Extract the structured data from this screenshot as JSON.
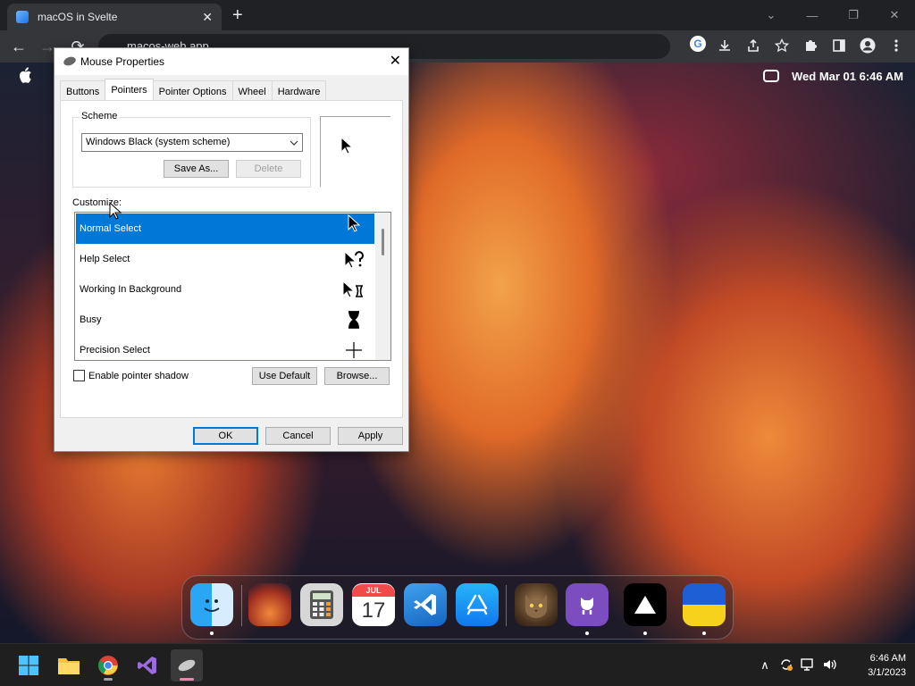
{
  "browser": {
    "tab_title": "macOS in Svelte",
    "tab_close": "✕",
    "new_tab": "+",
    "url": "macos-web.app",
    "back": "←",
    "forward": "→",
    "reload": "⟳",
    "win_min": "—",
    "win_restore": "❐",
    "win_close": "✕",
    "chevron": "⌄",
    "google": "G"
  },
  "menubar": {
    "apple": "",
    "clock": "Wed Mar 01  6:46 AM"
  },
  "dialog": {
    "title": "Mouse Properties",
    "close": "✕",
    "tabs": [
      {
        "label": "Buttons"
      },
      {
        "label": "Pointers",
        "active": true
      },
      {
        "label": "Pointer Options"
      },
      {
        "label": "Wheel"
      },
      {
        "label": "Hardware"
      }
    ],
    "scheme": {
      "legend": "Scheme",
      "selected": "Windows Black (system scheme)",
      "save_as": "Save As...",
      "delete": "Delete"
    },
    "customize_label": "Customize:",
    "cursors": [
      {
        "name": "Normal Select",
        "icon": "➤",
        "selected": true
      },
      {
        "name": "Help Select",
        "icon": "➤?"
      },
      {
        "name": "Working In Background",
        "icon": "➤⧗"
      },
      {
        "name": "Busy",
        "icon": "⧗"
      },
      {
        "name": "Precision Select",
        "icon": "+"
      }
    ],
    "pointer_shadow_label": "Enable pointer shadow",
    "pointer_shadow_checked": false,
    "use_default": "Use Default",
    "browse": "Browse...",
    "ok": "OK",
    "cancel": "Cancel",
    "apply": "Apply"
  },
  "dock": {
    "apps": [
      {
        "name": "Finder",
        "running": true
      },
      {
        "name": "Wallpapers",
        "running": false
      },
      {
        "name": "Calculator",
        "running": false
      },
      {
        "name": "Calendar",
        "month": "JUL",
        "day": "17",
        "running": false
      },
      {
        "name": "VS Code",
        "running": false
      },
      {
        "name": "App Store",
        "running": false
      },
      {
        "name": "Purrfect",
        "running": false
      },
      {
        "name": "GitHub",
        "running": true
      },
      {
        "name": "Vercel",
        "running": true
      },
      {
        "name": "Ukraine",
        "running": true
      }
    ]
  },
  "taskbar": {
    "clock_time": "6:46 AM",
    "clock_date": "3/1/2023",
    "tray_chevron": "∧",
    "tray_sound": "🔊"
  }
}
